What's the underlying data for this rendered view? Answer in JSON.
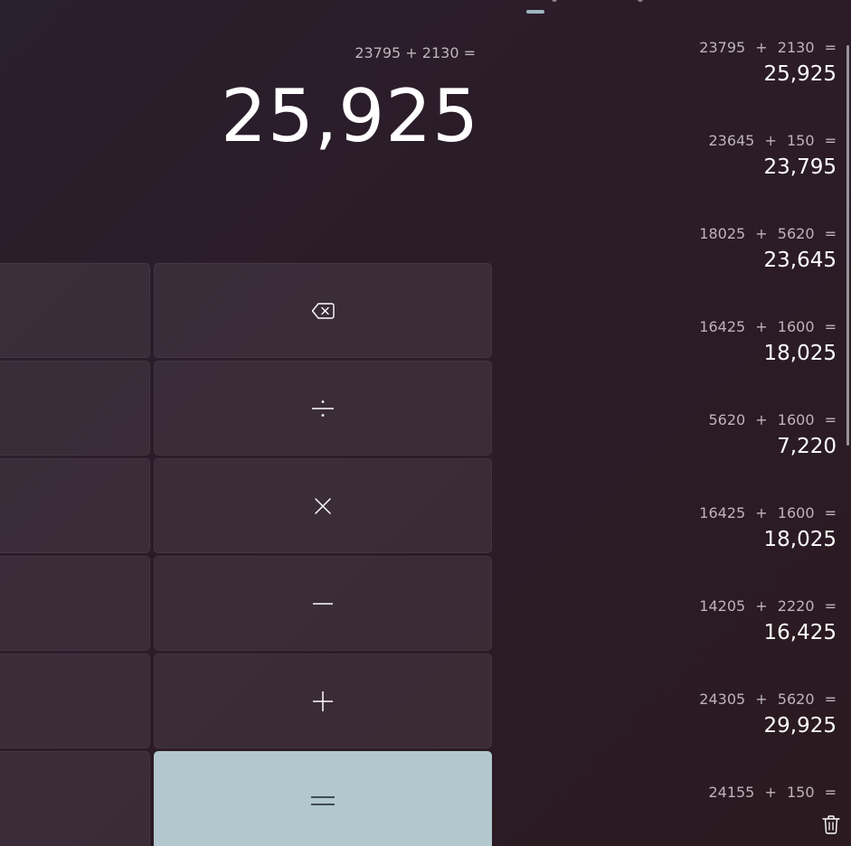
{
  "display": {
    "expression": "23795 + 2130 =",
    "result": "25,925"
  },
  "keypad": {
    "backspace": "backspace-icon",
    "divide": "÷",
    "multiply": "×",
    "subtract": "−",
    "add": "+",
    "equals": "=",
    "equals_color": "#b2c8ce"
  },
  "history": [
    {
      "a": "23795",
      "op": "+",
      "b": "2130",
      "eq": "=",
      "result": "25,925"
    },
    {
      "a": "23645",
      "op": "+",
      "b": "150",
      "eq": "=",
      "result": "23,795"
    },
    {
      "a": "18025",
      "op": "+",
      "b": "5620",
      "eq": "=",
      "result": "23,645"
    },
    {
      "a": "16425",
      "op": "+",
      "b": "1600",
      "eq": "=",
      "result": "18,025"
    },
    {
      "a": "5620",
      "op": "+",
      "b": "1600",
      "eq": "=",
      "result": "7,220"
    },
    {
      "a": "16425",
      "op": "+",
      "b": "1600",
      "eq": "=",
      "result": "18,025"
    },
    {
      "a": "14205",
      "op": "+",
      "b": "2220",
      "eq": "=",
      "result": "16,425"
    },
    {
      "a": "24305",
      "op": "+",
      "b": "5620",
      "eq": "=",
      "result": "29,925"
    },
    {
      "a": "24155",
      "op": "+",
      "b": "150",
      "eq": "=",
      "result": ""
    }
  ],
  "history_actions": {
    "delete_icon": "trash-icon"
  },
  "accent_color": "#9fb6c2"
}
